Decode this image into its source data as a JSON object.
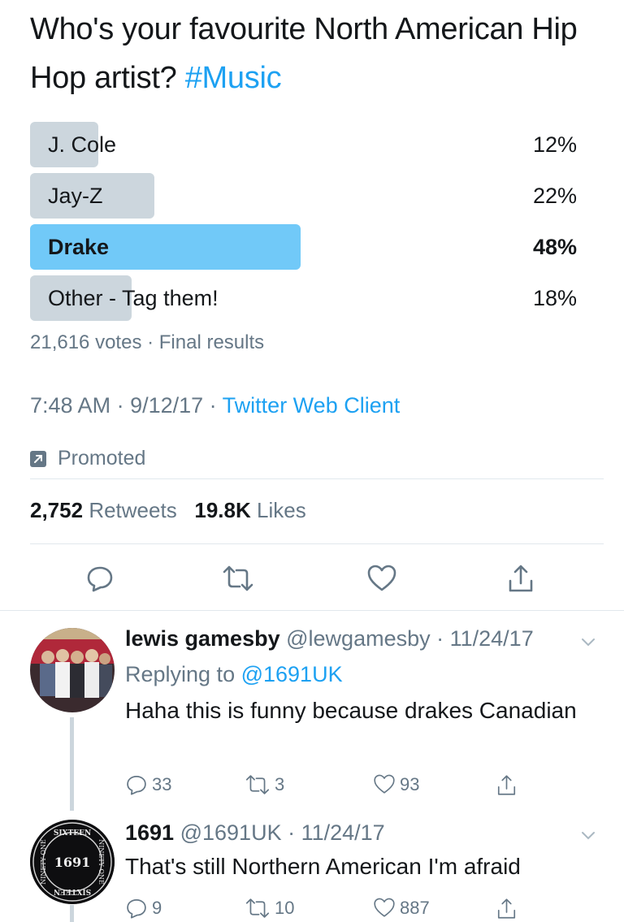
{
  "tweet": {
    "text": "Who's your favourite North American Hip Hop artist? ",
    "hashtag": "#Music"
  },
  "poll": {
    "options": [
      {
        "label": "J. Cole",
        "percent_label": "12%",
        "percent": 12,
        "winner": false
      },
      {
        "label": "Jay-Z",
        "percent_label": "22%",
        "percent": 22,
        "winner": false
      },
      {
        "label": "Drake",
        "percent_label": "48%",
        "percent": 48,
        "winner": true
      },
      {
        "label": "Other - Tag them!",
        "percent_label": "18%",
        "percent": 18,
        "winner": false
      }
    ],
    "votes": "21,616 votes",
    "separator": " · ",
    "status": "Final results"
  },
  "meta": {
    "time": "7:48 AM",
    "date": "9/12/17",
    "client": "Twitter Web Client",
    "separator": " · "
  },
  "promoted": {
    "label": "Promoted"
  },
  "stats": {
    "retweets_count": "2,752",
    "retweets_label": "Retweets",
    "likes_count": "19.8K",
    "likes_label": "Likes"
  },
  "actions": [
    "reply-icon",
    "retweet-icon",
    "heart-icon",
    "share-icon"
  ],
  "replies": [
    {
      "name": "lewis gamesby",
      "handle": "@lewgamesby",
      "date": "11/24/17",
      "replying_prefix": "Replying to ",
      "replying_to": "@1691UK",
      "body": "Haha this is funny because drakes Canadian",
      "reply_count": "33",
      "retweet_count": "3",
      "like_count": "93"
    },
    {
      "name": "1691",
      "handle": "@1691UK",
      "date": "11/24/17",
      "body": "That's still Northern American I'm afraid",
      "reply_count": "9",
      "retweet_count": "10",
      "like_count": "887",
      "avatar_text": "1691",
      "avatar_ring_text": "SIXTEEN NINETY ONE"
    }
  ],
  "colors": {
    "accent": "#1da1f2",
    "poll_bar": "#ccd6dd",
    "poll_winner": "#71c9f8",
    "secondary_text": "#657786"
  }
}
